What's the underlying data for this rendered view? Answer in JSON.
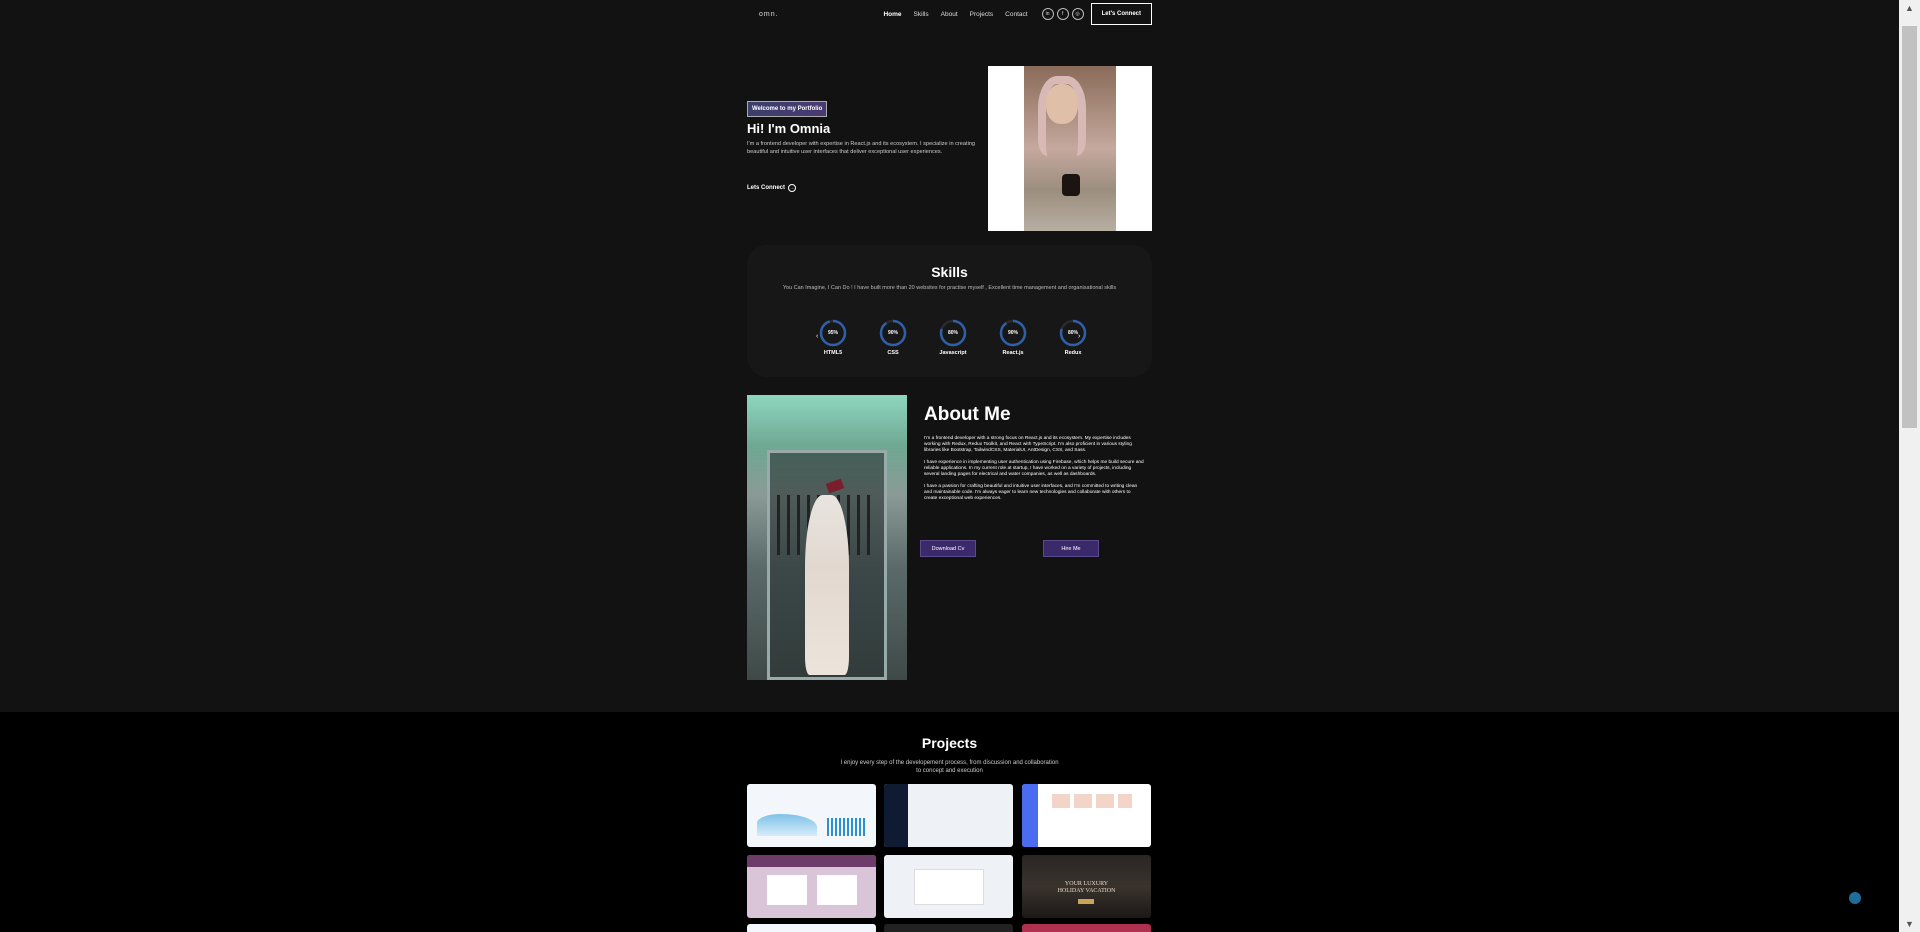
{
  "nav": {
    "logo": "omn.",
    "links": [
      "Home",
      "Skills",
      "About",
      "Projects",
      "Contact"
    ],
    "socials": [
      "in",
      "f",
      "ig"
    ],
    "connect_label": "Let's Connect"
  },
  "hero": {
    "tagline": "Welcome to my Portfolio",
    "title": "Hi! I'm Omnia",
    "description": "I'm a frontend developer with expertise in React.js and its ecosystem. I specialize in creating beautiful and intuitive user interfaces that deliver exceptional user experiences.",
    "cta_label": "Lets Connect",
    "cta_icon": "arrow-right-circle-icon"
  },
  "skills": {
    "title": "Skills",
    "subtitle": "You Can Imagine, I Can Do ! I have built more than 20 websites for practise myself , Excellent time management and organisational skills",
    "items": [
      {
        "name": "HTML5",
        "percent": 95,
        "label": "95%"
      },
      {
        "name": "CSS",
        "percent": 90,
        "label": "90%"
      },
      {
        "name": "Javascript",
        "percent": 80,
        "label": "80%"
      },
      {
        "name": "React.js",
        "percent": 90,
        "label": "90%"
      },
      {
        "name": "Redux",
        "percent": 80,
        "label": "80%"
      }
    ],
    "accent": "#2f5fa8"
  },
  "about": {
    "title": "About Me",
    "paragraphs": [
      "I'm a frontend developer with a strong focus on React.js and its ecosystem. My expertise includes working with Redux, Redux Toolkit, and React with TypeScript. I'm also proficient in various styling libraries like Bootstrap, TailwindCSS, MaterialUI, AntDesign, CSS, and Sass.",
      "I have experience in implementing user authentication using Firebase, which helps me build secure and reliable applications. In my current role at startup, I have worked on a variety of projects, including several landing pages for electrical and water companies, as well as dashboards.",
      "I have a passion for crafting beautiful and intuitive user interfaces, and I'm committed to writing clean and maintainable code. I'm always eager to learn new technologies and collaborate with others to create exceptional web experiences."
    ],
    "download_label": "Download Cv",
    "hire_label": "Hire Me",
    "button_color": "#3b2a6b"
  },
  "projects": {
    "title": "Projects",
    "subtitle_line1": "I enjoy every step of the developement process, from discussion and collaboration",
    "subtitle_line2": "to concept and execution",
    "tile_text": "YOUR LUXURY\nHOLIDAY VACATION"
  }
}
